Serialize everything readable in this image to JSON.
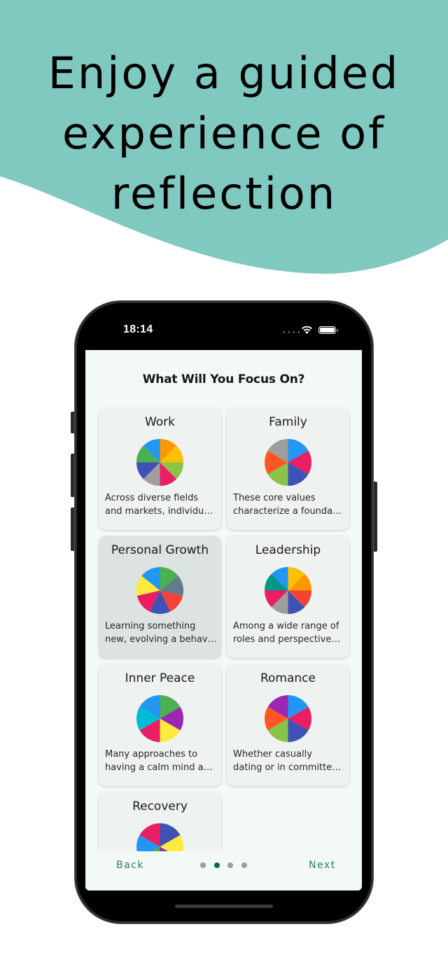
{
  "promo": {
    "headline_lines": [
      "Enjoy a guided",
      "experience of",
      "reflection"
    ],
    "background_color": "#7fc9c1"
  },
  "status_bar": {
    "time": "18:14",
    "signal_icon": "signal-dots-icon",
    "wifi_icon": "wifi-icon",
    "battery_icon": "battery-icon"
  },
  "screen": {
    "title": "What Will You Focus On?",
    "background_color": "#f3f9f7",
    "cards": [
      {
        "title": "Work",
        "desc_lines": [
          "Across diverse fields",
          "and markets, individua..."
        ],
        "selected": false,
        "wheel_colors": [
          "#ff9800",
          "#ffc107",
          "#8bc34a",
          "#e91e63",
          "#9e9e9e",
          "#3f51b5",
          "#4caf50",
          "#2196f3"
        ]
      },
      {
        "title": "Family",
        "desc_lines": [
          "These core values",
          "characterize a foundati..."
        ],
        "selected": false,
        "wheel_colors": [
          "#2196f3",
          "#e91e63",
          "#3f51b5",
          "#8bc34a",
          "#ff5722",
          "#9e9e9e"
        ]
      },
      {
        "title": "Personal Growth",
        "desc_lines": [
          "Learning something",
          "new, evolving a behavi..."
        ],
        "selected": true,
        "wheel_colors": [
          "#4caf50",
          "#607d8b",
          "#f44336",
          "#3f51b5",
          "#e91e63",
          "#ffeb3b",
          "#2196f3"
        ]
      },
      {
        "title": "Leadership",
        "desc_lines": [
          "Among a wide range of",
          "roles and perspectives,..."
        ],
        "selected": false,
        "wheel_colors": [
          "#ffc107",
          "#ff9800",
          "#f44336",
          "#3f51b5",
          "#9e9e9e",
          "#e91e63",
          "#009688",
          "#2196f3"
        ]
      },
      {
        "title": "Inner Peace",
        "desc_lines": [
          "Many approaches to",
          "having a calm mind an..."
        ],
        "selected": false,
        "wheel_colors": [
          "#4caf50",
          "#9c27b0",
          "#ffeb3b",
          "#e91e63",
          "#00bcd4",
          "#2196f3"
        ]
      },
      {
        "title": "Romance",
        "desc_lines": [
          "Whether casually",
          "dating or in committed..."
        ],
        "selected": false,
        "wheel_colors": [
          "#2196f3",
          "#e91e63",
          "#3f51b5",
          "#8bc34a",
          "#ff5722",
          "#9c27b0"
        ]
      },
      {
        "title": "Recovery",
        "desc_lines": [
          "",
          ""
        ],
        "selected": false,
        "wheel_colors": [
          "#3f51b5",
          "#ffeb3b",
          "#9c27b0",
          "#4caf50",
          "#2196f3",
          "#e91e63"
        ]
      }
    ]
  },
  "footer": {
    "back_label": "Back",
    "next_label": "Next",
    "page_count": 4,
    "current_page": 2,
    "accent_color": "#2a7a72",
    "active_dot_color": "#00695c",
    "inactive_dot_color": "#9e9e9e"
  }
}
